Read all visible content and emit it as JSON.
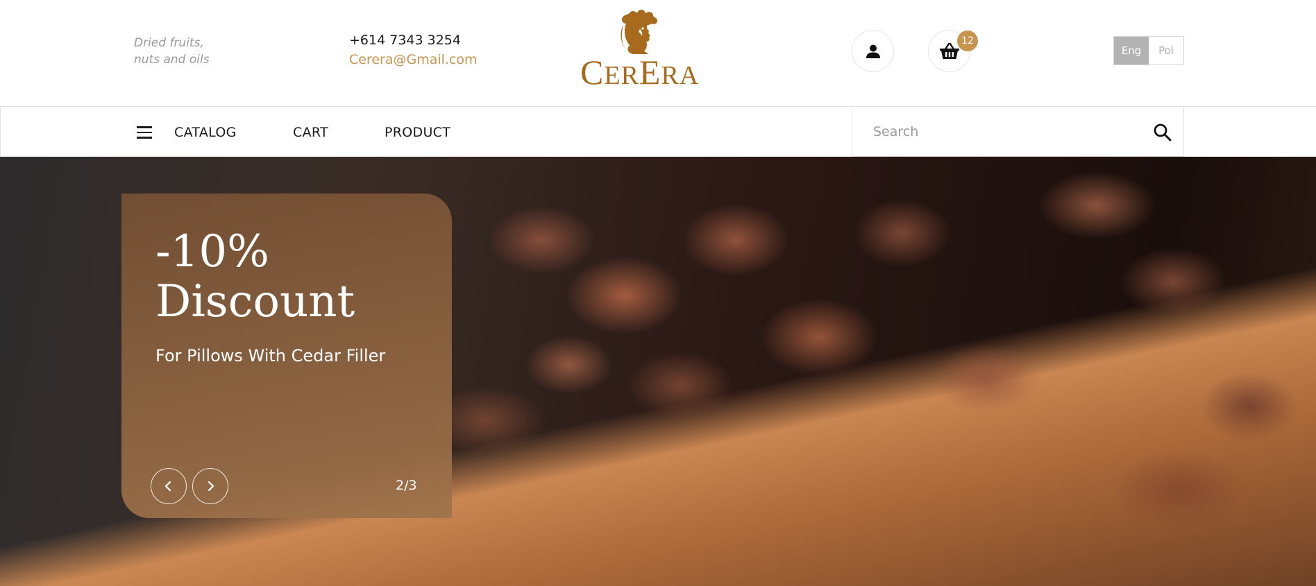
{
  "header": {
    "tagline_line1": "Dried fruits,",
    "tagline_line2": "nuts and oils",
    "phone": "+614 7343 3254",
    "email": "Cerera@Gmail.com",
    "logo_text_cap1": "C",
    "logo_text_mid": "ER",
    "logo_text_cap2": "E",
    "logo_text_end": "RA",
    "user_icon": "user-icon",
    "cart_icon": "basket-icon",
    "cart_count": "12",
    "languages": [
      "Eng",
      "Pol"
    ],
    "active_language": "Eng"
  },
  "nav": {
    "menu_icon": "hamburger-icon",
    "items": [
      "CATALOG",
      "CART",
      "PRODUCT"
    ]
  },
  "search": {
    "placeholder": "Search",
    "icon": "search-icon"
  },
  "hero": {
    "title_line1": "-10%",
    "title_line2": "Discount",
    "subtitle": "For Pillows With Cedar Filler",
    "prev_icon": "chevron-left-icon",
    "next_icon": "chevron-right-icon",
    "pager": "2/3"
  },
  "colors": {
    "accent": "#c8954f",
    "logo": "#a86a1c",
    "text": "#1a1a1a",
    "muted": "#9a9a9a",
    "promo_panel": "#7f5838"
  }
}
